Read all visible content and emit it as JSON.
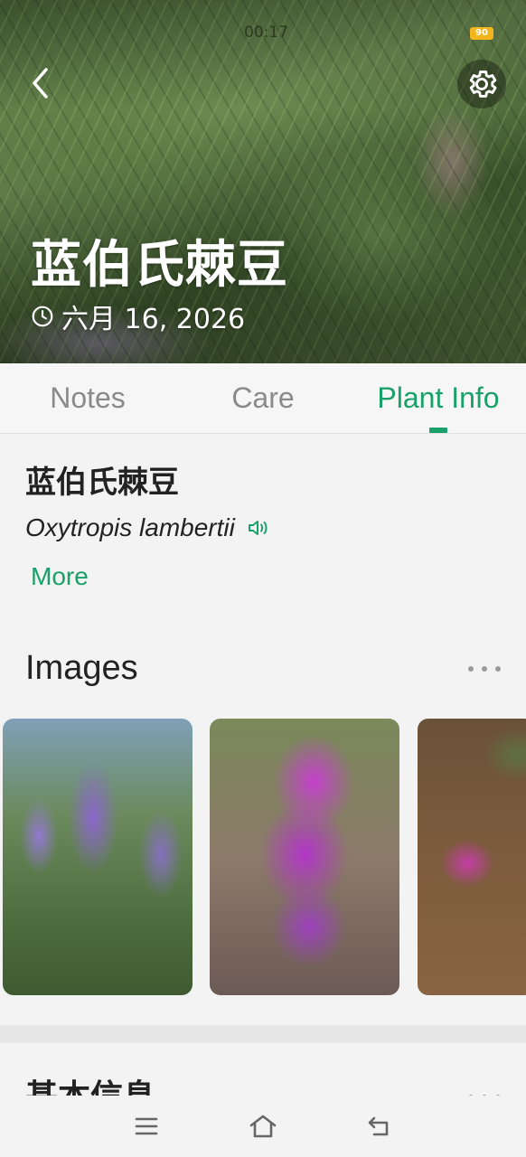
{
  "status": {
    "time": "00:17",
    "battery": "90"
  },
  "header": {
    "title": "蓝伯氏棘豆",
    "date": "六月 16, 2026"
  },
  "tabs": [
    {
      "label": "Notes",
      "active": false
    },
    {
      "label": "Care",
      "active": false
    },
    {
      "label": "Plant Info",
      "active": true
    }
  ],
  "plant": {
    "name": "蓝伯氏棘豆",
    "latin": "Oxytropis lambertii",
    "more_label": "More"
  },
  "images_section": {
    "title": "Images",
    "count_visible": 3
  },
  "basic_section": {
    "title": "基本信息"
  },
  "colors": {
    "accent": "#1aa06a",
    "battery": "#f2b51b"
  },
  "icons": {
    "back": "chevron-left-icon",
    "settings": "gear-icon",
    "clock": "clock-icon",
    "speaker": "speaker-icon",
    "more": "more-dots-icon",
    "menu": "menu-icon",
    "home": "home-icon",
    "back_nav": "back-arrow-icon"
  }
}
